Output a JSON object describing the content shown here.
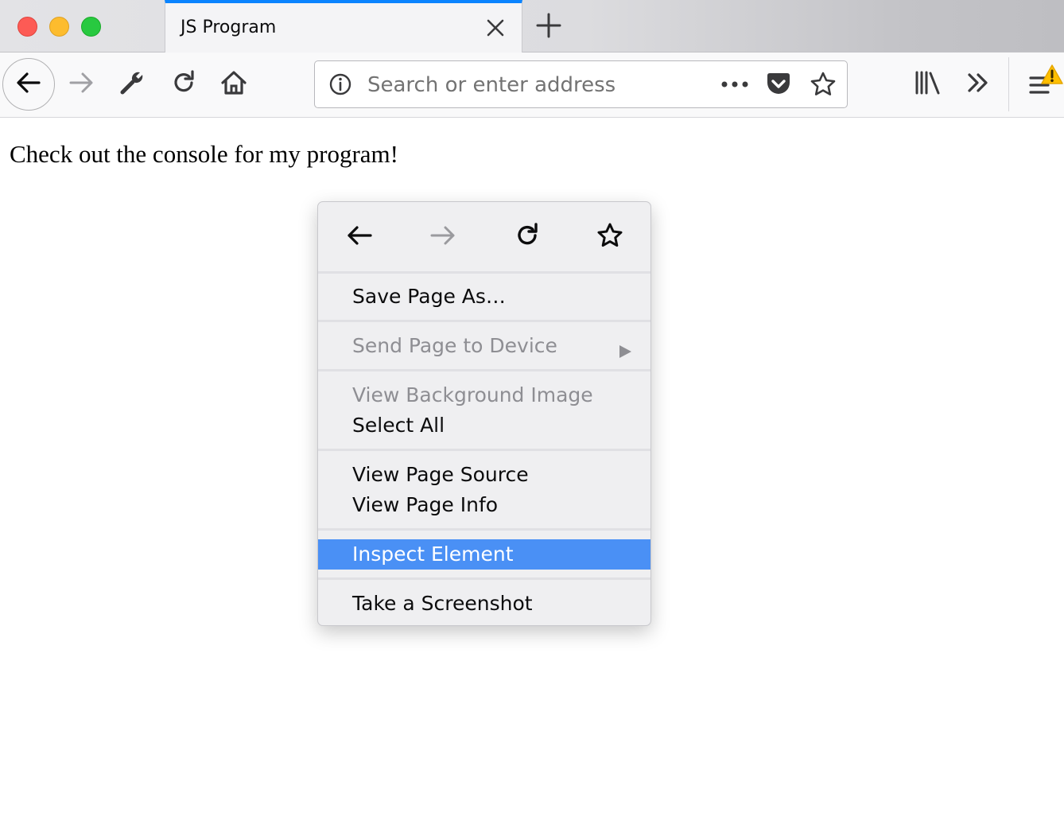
{
  "window": {
    "buttons": [
      "close",
      "minimize",
      "zoom"
    ]
  },
  "tabs": [
    {
      "title": "JS Program",
      "active": true,
      "close_icon": "close-icon"
    }
  ],
  "new_tab_icon": "plus-icon",
  "navbar": {
    "buttons": [
      "back-arrow-icon",
      "forward-arrow-icon",
      "wrench-icon",
      "reload-icon",
      "home-icon"
    ],
    "url": {
      "value": "",
      "placeholder": "Search or enter address",
      "left_icon": "info-icon",
      "right_icons": [
        "more-dots-icon",
        "pocket-icon",
        "bookmark-star-icon"
      ]
    },
    "right_buttons": [
      "library-icon",
      "overflow-chevron-icon",
      "hamburger-menu-icon",
      "warning-icon"
    ]
  },
  "page": {
    "text": "Check out the console for my program!"
  },
  "context_menu": {
    "nav_icons": [
      "back-arrow-icon",
      "forward-arrow-icon",
      "reload-icon",
      "bookmark-star-icon"
    ],
    "items": {
      "save_page_as": "Save Page As…",
      "send_page_to_device": "Send Page to Device",
      "view_background_image": "View Background Image",
      "select_all": "Select All",
      "view_page_source": "View Page Source",
      "view_page_info": "View Page Info",
      "inspect_element": "Inspect Element",
      "take_screenshot": "Take a Screenshot"
    },
    "highlighted_item": "Inspect Element",
    "highlight_color": "#4a90f5"
  },
  "colors": {
    "active_tab_accent": "#0a84ff",
    "warning": "#ffbf00",
    "disabled_text": "#8e8e93"
  }
}
